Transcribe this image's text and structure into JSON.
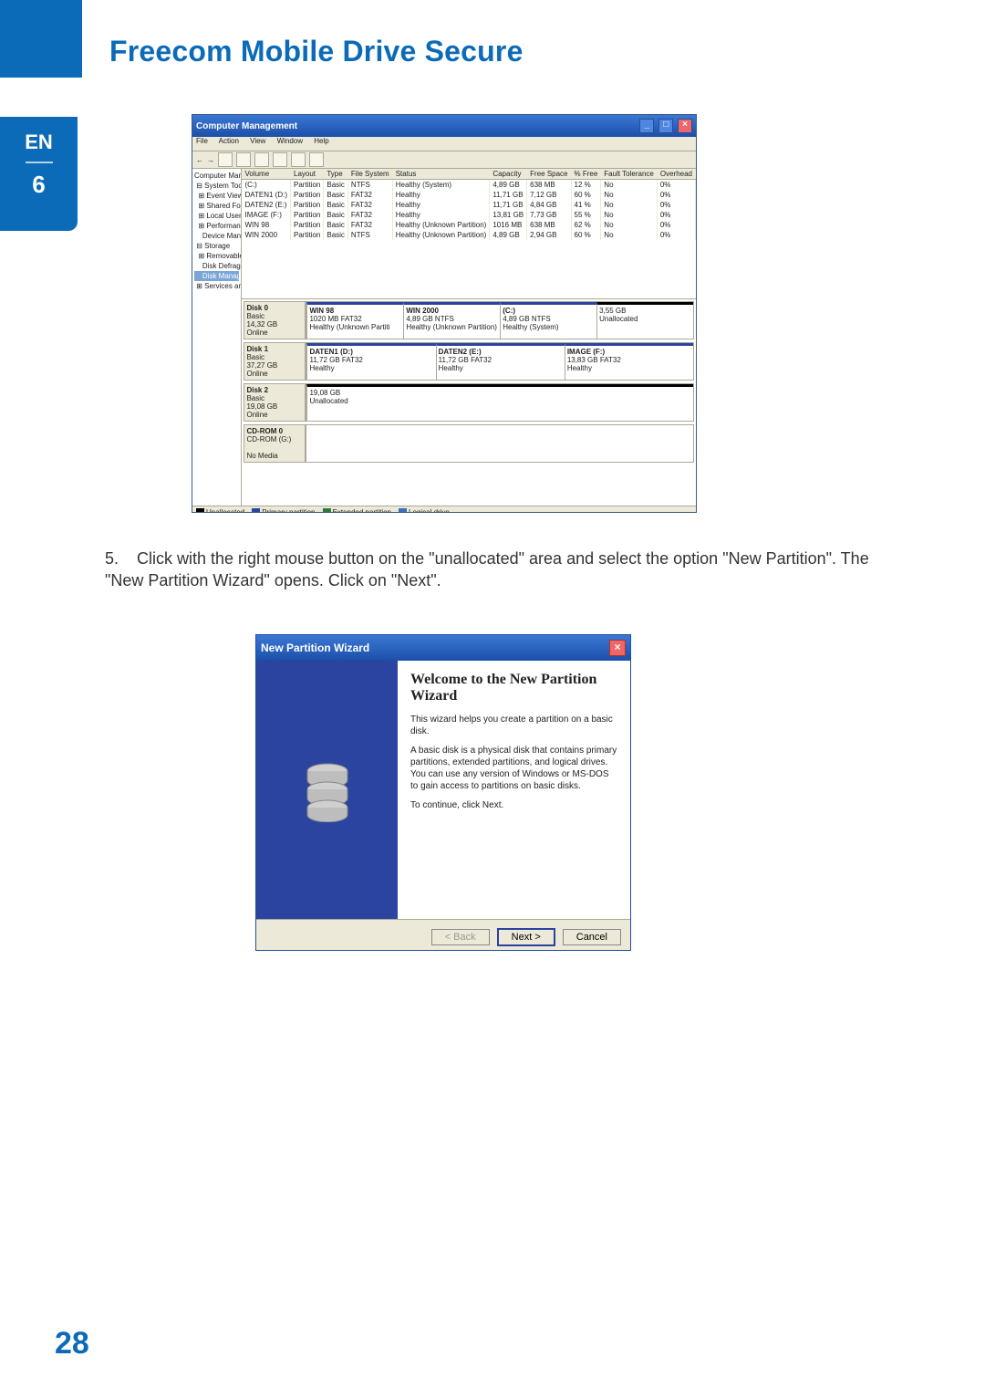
{
  "header": {
    "title": "Freecom Mobile Drive Secure"
  },
  "side_tab": {
    "lang": "EN",
    "chapter": "6"
  },
  "page_number": "28",
  "instruction": {
    "number": "5.",
    "text": "Click with the right mouse button on the \"unallocated\" area and select the option \"New Partition\". The \"New Partition Wizard\" opens. Click on \"Next\"."
  },
  "cm": {
    "window_title": "Computer Management",
    "menu": [
      "File",
      "Action",
      "View",
      "Window",
      "Help"
    ],
    "tree": {
      "root": "Computer Management (Local)",
      "system_tools": "System Tools",
      "items": [
        "Event Viewer",
        "Shared Folders",
        "Local Users and Groups",
        "Performance Logs and Alerts",
        "Device Manager"
      ],
      "storage": "Storage",
      "storage_items": [
        "Removable Storage",
        "Disk Defragmenter",
        "Disk Management"
      ],
      "services": "Services and Applications"
    },
    "columns": [
      "Volume",
      "Layout",
      "Type",
      "File System",
      "Status",
      "Capacity",
      "Free Space",
      "% Free",
      "Fault Tolerance",
      "Overhead"
    ],
    "rows": [
      {
        "vol": "(C:)",
        "layout": "Partition",
        "type": "Basic",
        "fs": "NTFS",
        "status": "Healthy (System)",
        "cap": "4,89 GB",
        "free": "638 MB",
        "pct": "12 %",
        "ft": "No",
        "oh": "0%"
      },
      {
        "vol": "DATEN1 (D:)",
        "layout": "Partition",
        "type": "Basic",
        "fs": "FAT32",
        "status": "Healthy",
        "cap": "11,71 GB",
        "free": "7,12 GB",
        "pct": "60 %",
        "ft": "No",
        "oh": "0%"
      },
      {
        "vol": "DATEN2 (E:)",
        "layout": "Partition",
        "type": "Basic",
        "fs": "FAT32",
        "status": "Healthy",
        "cap": "11,71 GB",
        "free": "4,84 GB",
        "pct": "41 %",
        "ft": "No",
        "oh": "0%"
      },
      {
        "vol": "IMAGE (F:)",
        "layout": "Partition",
        "type": "Basic",
        "fs": "FAT32",
        "status": "Healthy",
        "cap": "13,81 GB",
        "free": "7,73 GB",
        "pct": "55 %",
        "ft": "No",
        "oh": "0%"
      },
      {
        "vol": "WIN 98",
        "layout": "Partition",
        "type": "Basic",
        "fs": "FAT32",
        "status": "Healthy (Unknown Partition)",
        "cap": "1016 MB",
        "free": "638 MB",
        "pct": "62 %",
        "ft": "No",
        "oh": "0%"
      },
      {
        "vol": "WIN 2000",
        "layout": "Partition",
        "type": "Basic",
        "fs": "NTFS",
        "status": "Healthy (Unknown Partition)",
        "cap": "4,89 GB",
        "free": "2,94 GB",
        "pct": "60 %",
        "ft": "No",
        "oh": "0%"
      }
    ],
    "disks": [
      {
        "name": "Disk 0",
        "kind": "Basic",
        "size": "14,32 GB",
        "state": "Online",
        "parts": [
          {
            "title": "WIN 98",
            "sub": "1020 MB FAT32",
            "st": "Healthy (Unknown Partiti"
          },
          {
            "title": "WIN 2000",
            "sub": "4,89 GB NTFS",
            "st": "Healthy (Unknown Partition)"
          },
          {
            "title": "(C:)",
            "sub": "4,89 GB NTFS",
            "st": "Healthy (System)"
          },
          {
            "title": "",
            "sub": "3,55 GB",
            "st": "Unallocated",
            "unalloc": true
          }
        ]
      },
      {
        "name": "Disk 1",
        "kind": "Basic",
        "size": "37,27 GB",
        "state": "Online",
        "parts": [
          {
            "title": "DATEN1 (D:)",
            "sub": "11,72 GB FAT32",
            "st": "Healthy"
          },
          {
            "title": "DATEN2 (E:)",
            "sub": "11,72 GB FAT32",
            "st": "Healthy"
          },
          {
            "title": "IMAGE (F:)",
            "sub": "13,83 GB FAT32",
            "st": "Healthy"
          }
        ]
      },
      {
        "name": "Disk 2",
        "kind": "Basic",
        "size": "19,08 GB",
        "state": "Online",
        "parts": [
          {
            "title": "",
            "sub": "19,08 GB",
            "st": "Unallocated",
            "unalloc": true
          }
        ]
      },
      {
        "name": "CD-ROM 0",
        "kind": "CD-ROM (G:)",
        "size": "",
        "state": "No Media",
        "parts": []
      }
    ],
    "legend": {
      "un": "Unallocated",
      "pri": "Primary partition",
      "ext": "Extended partition",
      "log": "Logical drive"
    }
  },
  "wizard": {
    "title": "New Partition Wizard",
    "heading": "Welcome to the New Partition Wizard",
    "p1": "This wizard helps you create a partition on a basic disk.",
    "p2": "A basic disk is a physical disk that contains primary partitions, extended partitions, and logical drives. You can use any version of Windows or MS-DOS to gain access to partitions on basic disks.",
    "p3": "To continue, click Next.",
    "buttons": {
      "back": "< Back",
      "next": "Next >",
      "cancel": "Cancel"
    }
  }
}
